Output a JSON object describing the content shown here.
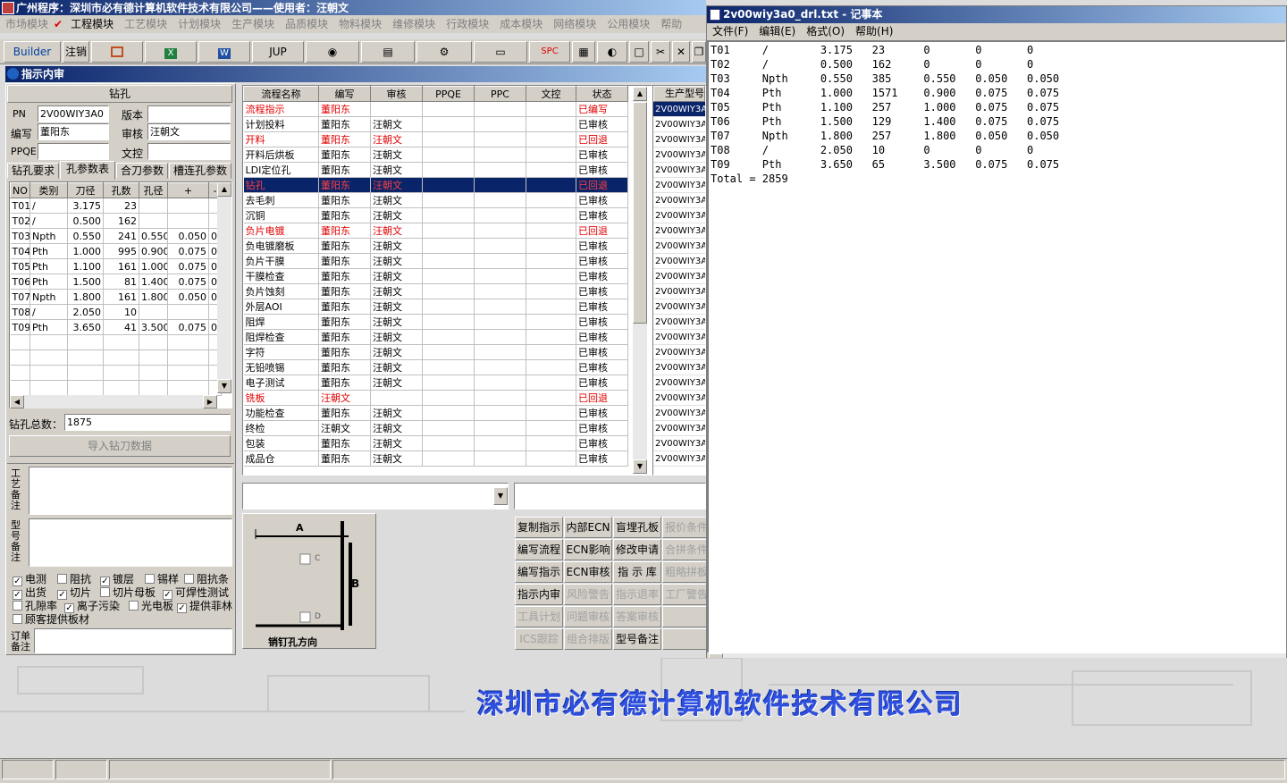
{
  "main_title": "广州程序：深圳市必有德计算机软件技术有限公司——使用者：汪朝文",
  "menu": [
    "市场模块",
    "工程模块",
    "工艺模块",
    "计划模块",
    "生产模块",
    "品质模块",
    "物料模块",
    "维修模块",
    "行政模块",
    "成本模块",
    "网络模块",
    "公用模块",
    "帮助"
  ],
  "toolbar": {
    "builder": "Builder",
    "logout": "注销",
    "jup": "JUP",
    "spc": "SPC"
  },
  "subwin_title": "指示内审",
  "drill": {
    "section": "钻孔",
    "pn_label": "PN",
    "pn": "2V00WIY3A0",
    "ver_label": "版本",
    "ver": "",
    "bianxie_label": "编写",
    "bianxie": "董阳东",
    "shenhe_label": "审核",
    "shenhe": "汪朝文",
    "ppqe_label": "PPQE",
    "ppqe": "",
    "wenkong_label": "文控",
    "wenkong": "",
    "tabs": [
      "钻孔要求",
      "孔参数表",
      "合刀参数",
      "槽连孔参数"
    ],
    "cols": [
      "NO",
      "类别",
      "刀径",
      "孔数",
      "孔径",
      "+",
      "-"
    ],
    "rows": [
      [
        "T01",
        "/",
        "3.175",
        "23",
        "",
        "",
        ""
      ],
      [
        "T02",
        "/",
        "0.500",
        "162",
        "",
        "",
        ""
      ],
      [
        "T03",
        "Npth",
        "0.550",
        "241",
        "0.550",
        "0.050",
        "0."
      ],
      [
        "T04",
        "Pth",
        "1.000",
        "995",
        "0.900",
        "0.075",
        "0."
      ],
      [
        "T05",
        "Pth",
        "1.100",
        "161",
        "1.000",
        "0.075",
        "0."
      ],
      [
        "T06",
        "Pth",
        "1.500",
        "81",
        "1.400",
        "0.075",
        "0."
      ],
      [
        "T07",
        "Npth",
        "1.800",
        "161",
        "1.800",
        "0.050",
        "0."
      ],
      [
        "T08",
        "/",
        "2.050",
        "10",
        "",
        "",
        ""
      ],
      [
        "T09",
        "Pth",
        "3.650",
        "41",
        "3.500",
        "0.075",
        "0."
      ]
    ],
    "total_label": "钻孔总数：",
    "total": "1875",
    "import_btn": "导入钻刀数据"
  },
  "remarks": {
    "gongyi": "工艺备注",
    "xinghao": "型号备注",
    "dingdan": "订单备注"
  },
  "checks": [
    [
      "电测",
      true
    ],
    [
      "阻抗",
      false
    ],
    [
      "镀层",
      true
    ],
    [
      "锡样",
      false
    ],
    [
      "阻抗条",
      false
    ],
    [
      "出货",
      true
    ],
    [
      "切片",
      true
    ],
    [
      "切片母板",
      false
    ],
    [
      "可焊性测试",
      true
    ],
    [
      "孔隙率",
      false
    ],
    [
      "离子污染",
      true
    ],
    [
      "光电板",
      false
    ],
    [
      "提供菲林",
      true
    ],
    [
      "顾客提供板材",
      false
    ]
  ],
  "flow": {
    "cols": [
      "流程名称",
      "编写",
      "审核",
      "PPQE",
      "PPC",
      "文控",
      "状态"
    ],
    "rows": [
      [
        "流程指示",
        "董阳东",
        "",
        "已编写",
        "r"
      ],
      [
        "计划投料",
        "董阳东",
        "汪朝文",
        "已审核",
        ""
      ],
      [
        "开料",
        "董阳东",
        "汪朝文",
        "已回退",
        "r"
      ],
      [
        "开料后烘板",
        "董阳东",
        "汪朝文",
        "已审核",
        ""
      ],
      [
        "LDI定位孔",
        "董阳东",
        "汪朝文",
        "已审核",
        ""
      ],
      [
        "钻孔",
        "董阳东",
        "汪朝文",
        "已回退",
        "s"
      ],
      [
        "去毛刺",
        "董阳东",
        "汪朝文",
        "已审核",
        ""
      ],
      [
        "沉铜",
        "董阳东",
        "汪朝文",
        "已审核",
        ""
      ],
      [
        "负片电镀",
        "董阳东",
        "汪朝文",
        "已回退",
        "r"
      ],
      [
        "负电镀磨板",
        "董阳东",
        "汪朝文",
        "已审核",
        ""
      ],
      [
        "负片干膜",
        "董阳东",
        "汪朝文",
        "已审核",
        ""
      ],
      [
        "干膜检查",
        "董阳东",
        "汪朝文",
        "已审核",
        ""
      ],
      [
        "负片蚀刻",
        "董阳东",
        "汪朝文",
        "已审核",
        ""
      ],
      [
        "外层AOI",
        "董阳东",
        "汪朝文",
        "已审核",
        ""
      ],
      [
        "阻焊",
        "董阳东",
        "汪朝文",
        "已审核",
        ""
      ],
      [
        "阻焊检查",
        "董阳东",
        "汪朝文",
        "已审核",
        ""
      ],
      [
        "字符",
        "董阳东",
        "汪朝文",
        "已审核",
        ""
      ],
      [
        "无铅喷锡",
        "董阳东",
        "汪朝文",
        "已审核",
        ""
      ],
      [
        "电子测试",
        "董阳东",
        "汪朝文",
        "已审核",
        ""
      ],
      [
        "铣板",
        "汪朝文",
        "",
        "已回退",
        "r"
      ],
      [
        "功能检查",
        "董阳东",
        "汪朝文",
        "已审核",
        ""
      ],
      [
        "终检",
        "汪朝文",
        "汪朝文",
        "已审核",
        ""
      ],
      [
        "包装",
        "董阳东",
        "汪朝文",
        "已审核",
        ""
      ],
      [
        "成品仓",
        "董阳东",
        "汪朝文",
        "已审核",
        ""
      ]
    ]
  },
  "model_col": {
    "header": "生产型号",
    "value": "2V00WIY3A"
  },
  "diagram": {
    "a": "A",
    "b": "B",
    "c": "C",
    "d": "D",
    "caption": "销钉孔方向"
  },
  "buttons": [
    [
      "复制指示",
      0
    ],
    [
      "内部ECN",
      0
    ],
    [
      "盲埋孔板",
      0
    ],
    [
      "报价条件",
      1
    ],
    [
      "编写流程",
      0
    ],
    [
      "ECN影响",
      0
    ],
    [
      "修改申请",
      0
    ],
    [
      "合拼条件",
      1
    ],
    [
      "编写指示",
      0
    ],
    [
      "ECN审核",
      0
    ],
    [
      "指 示 库",
      0
    ],
    [
      "粗略拼板",
      1
    ],
    [
      "指示内审",
      0
    ],
    [
      "风险警告",
      1
    ],
    [
      "指示退率",
      1
    ],
    [
      "工厂警告",
      1
    ],
    [
      "工具计划",
      1
    ],
    [
      "问题审核",
      1
    ],
    [
      "答案审核",
      1
    ],
    [
      "",
      0
    ],
    [
      "ICS跟踪",
      1
    ],
    [
      "组合排版",
      1
    ],
    [
      "型号备注",
      0
    ],
    [
      "",
      0
    ]
  ],
  "notepad": {
    "title": "2v00wiy3a0_drl.txt - 记事本",
    "menu": [
      "文件(F)",
      "编辑(E)",
      "格式(O)",
      "帮助(H)"
    ],
    "lines": [
      "T01     /        3.175   23      0       0       0",
      "T02     /        0.500   162     0       0       0",
      "T03     Npth     0.550   385     0.550   0.050   0.050",
      "T04     Pth      1.000   1571    0.900   0.075   0.075",
      "T05     Pth      1.100   257     1.000   0.075   0.075",
      "T06     Pth      1.500   129     1.400   0.075   0.075",
      "T07     Npth     1.800   257     1.800   0.050   0.050",
      "T08     /        2.050   10      0       0       0",
      "T09     Pth      3.650   65      3.500   0.075   0.075",
      "Total = 2859"
    ]
  },
  "banner": "深圳市必有德计算机软件技术有限公司"
}
